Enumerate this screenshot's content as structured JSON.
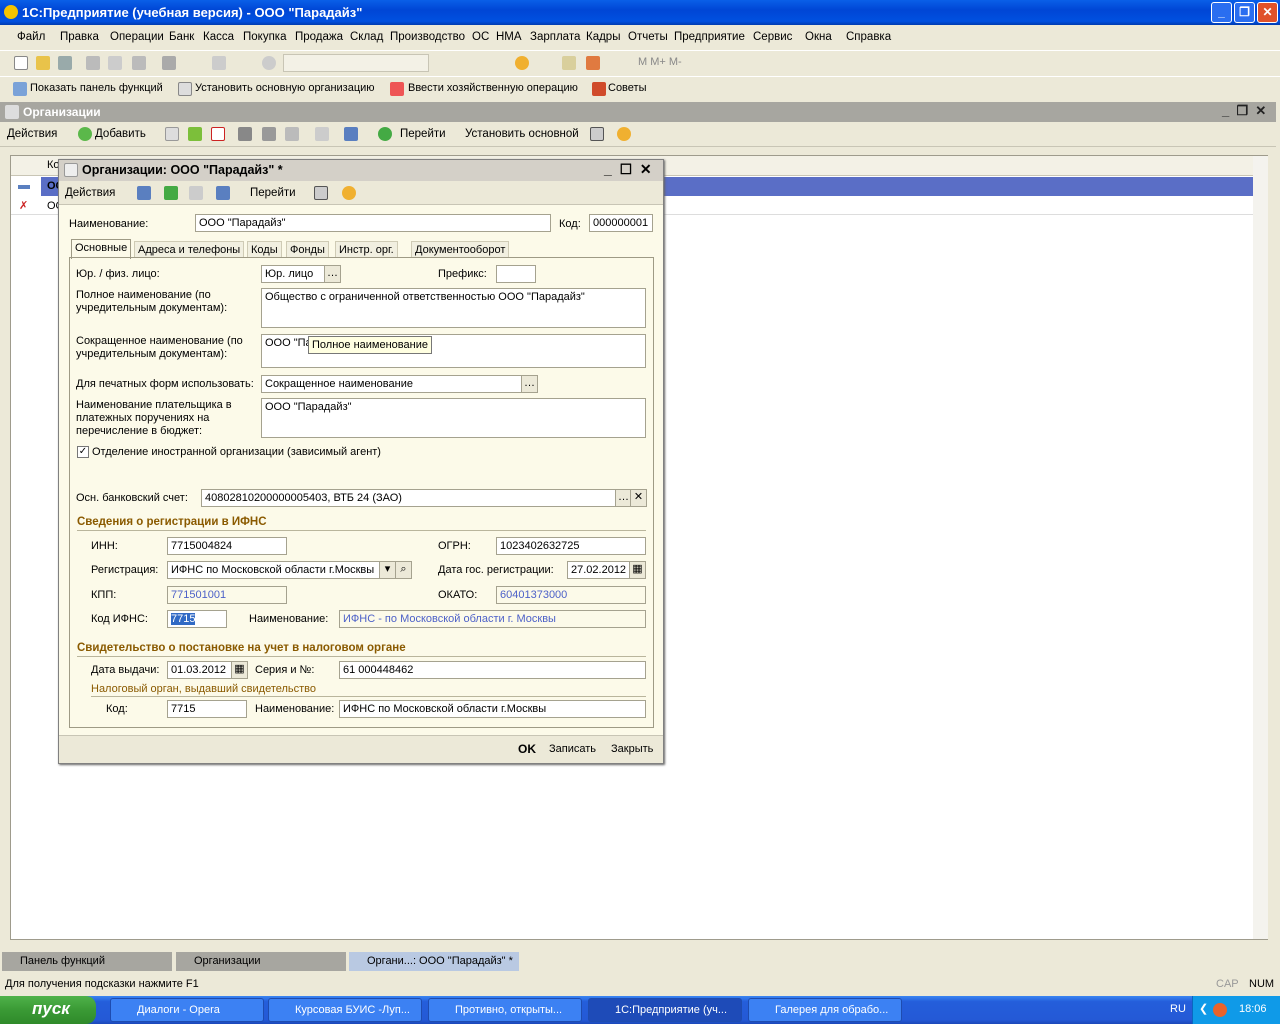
{
  "app": {
    "title": "1С:Предприятие (учебная версия) - ООО \"Парадайз\""
  },
  "menu": [
    "Файл",
    "Правка",
    "Операции",
    "Банк",
    "Касса",
    "Покупка",
    "Продажа",
    "Склад",
    "Производство",
    "ОС",
    "НМА",
    "Зарплата",
    "Кадры",
    "Отчеты",
    "Предприятие",
    "Сервис",
    "Окна",
    "Справка"
  ],
  "toolbar2": {
    "show_panel": "Показать панель функций",
    "set_main_org": "Установить основную организацию",
    "enter_operation": "Ввести хозяйственную операцию",
    "tips": "Советы"
  },
  "list_window": {
    "title": "Организации",
    "actions": "Действия",
    "add": "Добавить",
    "goto": "Перейти",
    "set_main": "Установить основной",
    "col_code": "Ко",
    "rows": [
      "ОО",
      "ОО"
    ]
  },
  "dialog": {
    "title": "Организации: ООО \"Парадайз\" *",
    "actions": "Действия",
    "goto": "Перейти",
    "name_label": "Наименование:",
    "name_value": "ООО \"Парадайз\"",
    "code_label": "Код:",
    "code_value": "000000001",
    "tabs": [
      "Основные",
      "Адреса и телефоны",
      "Коды",
      "Фонды",
      "Инстр. орг.",
      "Документооборот"
    ],
    "legal_label": "Юр. / физ. лицо:",
    "legal_value": "Юр. лицо",
    "prefix_label": "Префикс:",
    "prefix_value": "",
    "full_name_label": "Полное наименование (по учредительным документам):",
    "full_name_value": "Общество с ограниченной ответственностью  ООО \"Парадайз\"",
    "short_name_label": "Сокращенное наименование (по учредительным документам):",
    "short_name_value": "ООО \"Па",
    "tooltip": "Полное наименование",
    "print_label": "Для печатных форм использовать:",
    "print_value": "Сокращенное наименование",
    "payer_label": "Наименование плательщика в платежных поручениях на перечисление в бюджет:",
    "payer_value": "ООО \"Парадайз\"",
    "foreign_checkbox": "Отделение иностранной организации (зависимый агент)",
    "foreign_checked": true,
    "bank_label": "Осн. банковский счет:",
    "bank_value": "40802810200000005403, ВТБ 24 (ЗАО)",
    "ifns_section": "Сведения о регистрации в ИФНС",
    "inn_label": "ИНН:",
    "inn_value": "7715004824",
    "ogrn_label": "ОГРН:",
    "ogrn_value": "1023402632725",
    "reg_label": "Регистрация:",
    "reg_value": "ИФНС по Московской области г.Москвы",
    "reg_date_label": "Дата гос. регистрации:",
    "reg_date_value": "27.02.2012",
    "kpp_label": "КПП:",
    "kpp_value": "771501001",
    "okato_label": "ОКАТО:",
    "okato_value": "60401373000",
    "ifns_code_label": "Код ИФНС:",
    "ifns_code_value": "7715",
    "ifns_name_label": "Наименование:",
    "ifns_name_value": "ИФНС - по Московской области г. Москвы",
    "cert_section": "Свидетельство о постановке на учет в налоговом органе",
    "issue_date_label": "Дата выдачи:",
    "issue_date_value": "01.03.2012",
    "series_label": "Серия и №:",
    "series_value": "61 000448462",
    "tax_org_label": "Налоговый орган, выдавший свидетельство",
    "org_code_label": "Код:",
    "org_code_value": "7715",
    "org_name_label": "Наименование:",
    "org_name_value": "ИФНС по Московской области г.Москвы",
    "ok": "OK",
    "save": "Записать",
    "close": "Закрыть"
  },
  "taskpanel": [
    "Панель функций",
    "Организации",
    "Органи...: ООО \"Парадайз\" *"
  ],
  "status": {
    "hint": "Для получения подсказки нажмите F1",
    "cap": "CAP",
    "num": "NUM"
  },
  "taskbar": {
    "start": "пуск",
    "tasks": [
      "Диалоги - Opera",
      "Курсовая БУИС -Луп...",
      "Противно, открыты...",
      "1С:Предприятие (уч...",
      "Галерея для обрабо..."
    ],
    "lang": "RU",
    "time": "18:06"
  }
}
